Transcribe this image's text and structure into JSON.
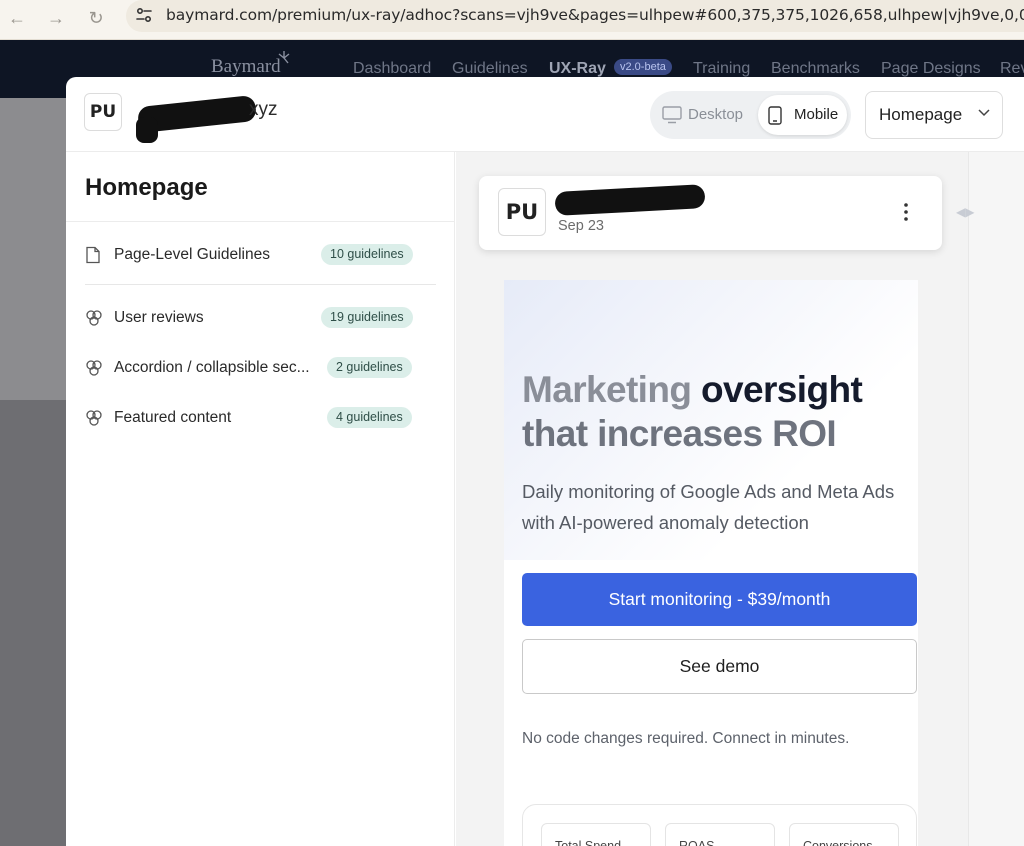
{
  "browser": {
    "back_icon": "arrow-left-icon",
    "forward_icon": "arrow-right-icon",
    "reload_icon": "reload-icon",
    "url": "baymard.com/premium/ux-ray/adhoc?scans=vjh9ve&pages=ulhpew#600,375,375,1026,658,ulhpew|vjh9ve,0,0"
  },
  "site_header": {
    "logo": "Baymard",
    "nav": [
      "Dashboard",
      "Guidelines",
      "UX-Ray",
      "Training",
      "Benchmarks",
      "Page Designs",
      "Rev"
    ],
    "beta_badge": "v2.0-beta"
  },
  "modal": {
    "avatar": "PU",
    "site_name_suffix": "xyz",
    "view_toggle": {
      "desktop": "Desktop",
      "mobile": "Mobile",
      "selected": "Mobile"
    },
    "page_select": "Homepage"
  },
  "sidebar": {
    "title": "Homepage",
    "items": [
      {
        "label": "Page-Level Guidelines",
        "count": "10 guidelines",
        "icon": "document-icon"
      },
      {
        "label": "User reviews",
        "count": "19 guidelines",
        "icon": "component-icon"
      },
      {
        "label": "Accordion / collapsible sec...",
        "count": "2 guidelines",
        "icon": "component-icon"
      },
      {
        "label": "Featured content",
        "count": "4 guidelines",
        "icon": "component-icon"
      }
    ]
  },
  "preview": {
    "card": {
      "avatar": "PU",
      "date": "Sep 23"
    },
    "hero": {
      "headline_muted": "Marketing",
      "headline_dark_1": "oversight",
      "headline_muted_2": "that increases ROI",
      "subtext": "Daily monitoring of Google Ads and Meta Ads with AI-powered anomaly detection",
      "primary_cta": "Start monitoring - $39/month",
      "secondary_cta": "See demo",
      "note": "No code changes required. Connect in minutes.",
      "stats": [
        "Total Spend",
        "ROAS",
        "Conversions"
      ]
    }
  }
}
